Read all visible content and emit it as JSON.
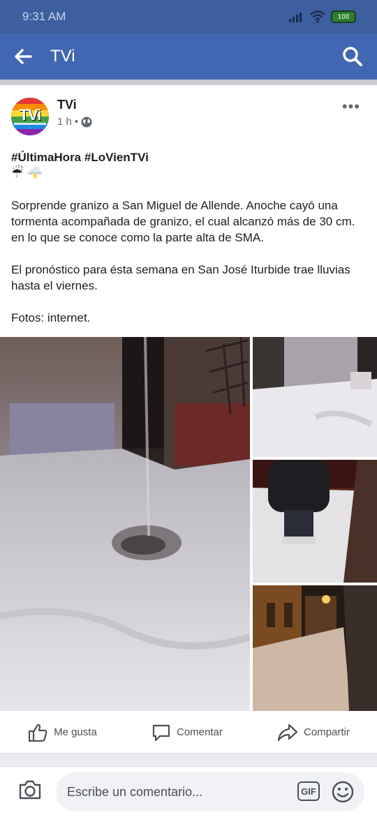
{
  "status_bar": {
    "time": "9:31 AM",
    "battery": "100"
  },
  "app_bar": {
    "title": "TVi"
  },
  "post": {
    "page_name": "TVi",
    "avatar_text": "TVi",
    "time_ago": "1 h",
    "privacy_dot": "•",
    "hashtags": "#ÚltimaHora #LoVienTVi",
    "emojis": "☔ 🌩️",
    "paragraph1": "Sorprende granizo a San Miguel de Allende. Anoche cayó una tormenta acompañada de granizo, el cual alcanzó más de 30 cm. en lo que se conoce como la parte alta de SMA.",
    "paragraph2": "El pronóstico para ésta semana en San José Iturbide trae lluvias hasta el viernes.",
    "paragraph3": "Fotos: internet."
  },
  "actions": {
    "like": "Me gusta",
    "comment": "Comentar",
    "share": "Compartir"
  },
  "comment_bar": {
    "placeholder": "Escribe un comentario...",
    "gif_label": "GIF"
  }
}
